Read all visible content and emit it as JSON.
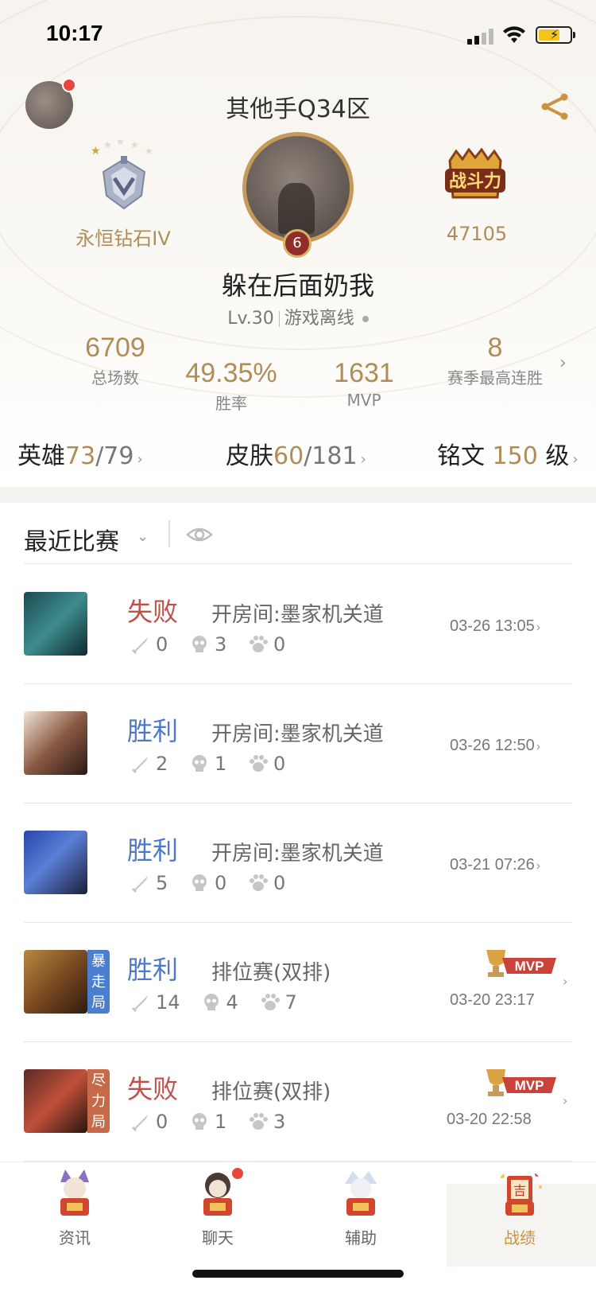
{
  "status_bar": {
    "time": "10:17"
  },
  "profile": {
    "server": "其他手Q34区",
    "rank_name": "永恒钻石IV",
    "combat_power": "47105",
    "level_badge": "6",
    "nickname": "躲在后面奶我",
    "level": "Lv.30",
    "online_status": "游戏离线"
  },
  "stats": {
    "total_games": {
      "value": "6709",
      "label": "总场数"
    },
    "win_rate": {
      "value": "49.35%",
      "label": "胜率"
    },
    "mvp": {
      "value": "1631",
      "label": "MVP"
    },
    "streak": {
      "value": "8",
      "label": "赛季最高连胜"
    }
  },
  "collection": {
    "heroes": {
      "label": "英雄",
      "owned": "73",
      "total": "/79"
    },
    "skins": {
      "label": "皮肤",
      "owned": "60",
      "total": "/181"
    },
    "inscriptions": {
      "label": "铭文",
      "value": "150",
      "unit": "级"
    }
  },
  "recent": {
    "title": "最近比赛"
  },
  "matches": [
    {
      "result": "失败",
      "mode": "开房间:墨家机关道",
      "kills": "0",
      "deaths": "3",
      "assists": "0",
      "time": "03-26 13:05",
      "tag": "",
      "mvp": false
    },
    {
      "result": "胜利",
      "mode": "开房间:墨家机关道",
      "kills": "2",
      "deaths": "1",
      "assists": "0",
      "time": "03-26 12:50",
      "tag": "",
      "mvp": false
    },
    {
      "result": "胜利",
      "mode": "开房间:墨家机关道",
      "kills": "5",
      "deaths": "0",
      "assists": "0",
      "time": "03-21 07:26",
      "tag": "",
      "mvp": false
    },
    {
      "result": "胜利",
      "mode": "排位赛(双排)",
      "kills": "14",
      "deaths": "4",
      "assists": "7",
      "time": "03-20 23:17",
      "tag": "暴走局",
      "mvp": true,
      "mvp_label": "MVP"
    },
    {
      "result": "失败",
      "mode": "排位赛(双排)",
      "kills": "0",
      "deaths": "1",
      "assists": "3",
      "time": "03-20 22:58",
      "tag": "尽力局",
      "mvp": true,
      "mvp_label": "MVP"
    }
  ],
  "tabs": [
    {
      "label": "资讯",
      "icon": "news-icon"
    },
    {
      "label": "聊天",
      "icon": "chat-icon"
    },
    {
      "label": "辅助",
      "icon": "assist-icon"
    },
    {
      "label": "战绩",
      "icon": "record-icon"
    }
  ],
  "colors": {
    "gold": "#b08d57",
    "win": "#4d79c7",
    "lose": "#c0504a",
    "tag_win": "#4a7fd0",
    "tag_lose": "#c76a4a"
  }
}
